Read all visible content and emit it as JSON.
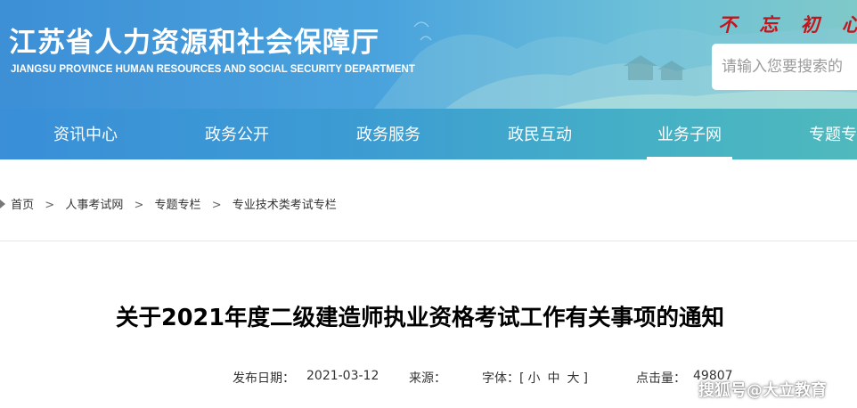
{
  "header": {
    "title": "江苏省人力资源和社会保障厅",
    "subtitle": "JIANGSU PROVINCE HUMAN RESOURCES AND SOCIAL SECURITY DEPARTMENT",
    "slogan": "不 忘 初 心",
    "search_placeholder": "请输入您要搜索的"
  },
  "nav": {
    "items": [
      {
        "label": "资讯中心"
      },
      {
        "label": "政务公开"
      },
      {
        "label": "政务服务"
      },
      {
        "label": "政民互动"
      },
      {
        "label": "业务子网",
        "active": true
      },
      {
        "label": "专题专"
      }
    ]
  },
  "breadcrumb": {
    "items": [
      "首页",
      "人事考试网",
      "专题专栏",
      "专业技术类考试专栏"
    ],
    "separator": ">"
  },
  "article": {
    "title": "关于2021年度二级建造师执业资格考试工作有关事项的通知",
    "publish_label": "发布日期：",
    "publish_date": "2021-03-12",
    "source_label": "来源：",
    "font_label": "字体：[",
    "font_small": "小",
    "font_medium": "中",
    "font_large": "大",
    "font_close": "]",
    "clicks_label": "点击量：",
    "clicks_value": "49807"
  },
  "watermark": "搜狐号@大立教育",
  "colors": {
    "header_blue": "#3d8fd6",
    "header_teal": "#7fc9c9",
    "slogan_red": "#c0171c",
    "nav_blue": "#3a8fd8"
  }
}
